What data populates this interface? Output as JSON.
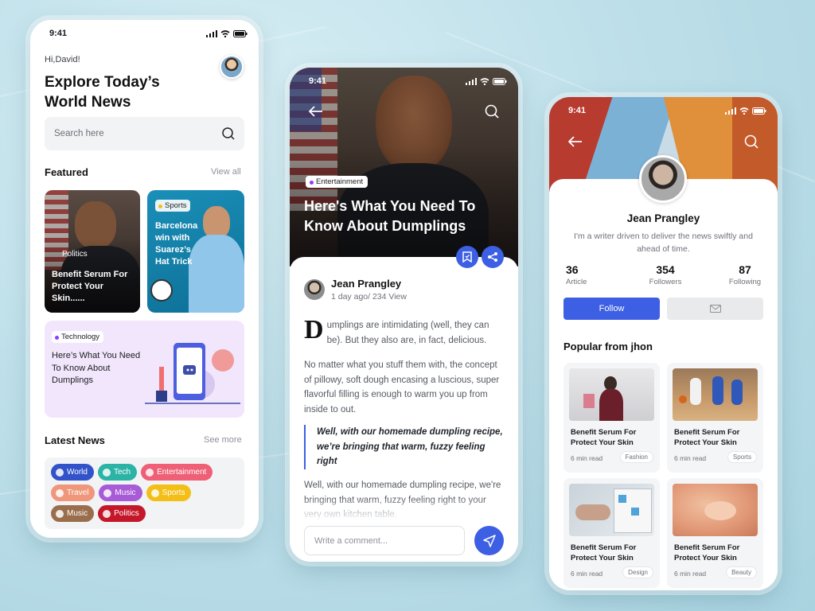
{
  "colors": {
    "accent": "#3d5fe3",
    "background": "#bfe0ea"
  },
  "home": {
    "time": "9:41",
    "greeting": "Hi,David!",
    "headline": "Explore Today’s World News",
    "search_placeholder": "Search here",
    "featured_title": "Featured",
    "featured_link": "View all",
    "featured": [
      {
        "tag": "Politics",
        "title": "Benefit Serum For Protect Your Skin......"
      },
      {
        "tag": "Sports",
        "title": "Barcelona win with Suarez’s Hat Trick"
      },
      {
        "tag": "Technology",
        "title": "Here’s What You Need To Know About Dumplings"
      }
    ],
    "latest_title": "Latest News",
    "latest_link": "See more",
    "categories": [
      {
        "label": "World",
        "color": "#3152c9",
        "icon": "globe-icon"
      },
      {
        "label": "Tech",
        "color": "#2bb3a6",
        "icon": "snowflake-icon"
      },
      {
        "label": "Entertainment",
        "color": "#ef5f76",
        "icon": "flower-icon"
      },
      {
        "label": "Travel",
        "color": "#f0967a",
        "icon": "globe-icon"
      },
      {
        "label": "Music",
        "color": "#a75bd6",
        "icon": "music-icon"
      },
      {
        "label": "Sports",
        "color": "#f3bf17",
        "icon": "sun-icon"
      },
      {
        "label": "Music",
        "color": "#9a6e4c",
        "icon": "music-icon"
      },
      {
        "label": "Politics",
        "color": "#c4172a",
        "icon": "flame-icon"
      }
    ]
  },
  "article": {
    "time": "9:41",
    "tag": "Entertainment",
    "title": "Here's What You Need To Know About Dumplings",
    "author": "Jean Prangley",
    "meta": "1 day ago/ 234 View",
    "dropcap": "D",
    "p1": "umplings are intimidating (well, they can be). But they also are, in fact, delicious.",
    "p2": "No matter what you stuff them with, the concept of pillowy, soft dough encasing a luscious, super flavorful filling is enough to warm you up from inside to out.",
    "quote": "Well, with our homemade dumpling recipe, we’re bringing that warm, fuzzy feeling right",
    "p3": "Well, with our homemade dumpling recipe, we're bringing that warm, fuzzy feeling right to your very own kitchen table.",
    "comment_placeholder": "Write a comment..."
  },
  "profile": {
    "time": "9:41",
    "name": "Jean Prangley",
    "bio": "I'm a writer driven to deliver the news swiftly and ahead of time.",
    "stats": [
      {
        "value": "36",
        "label": "Article"
      },
      {
        "value": "354",
        "label": "Followers"
      },
      {
        "value": "87",
        "label": "Following"
      }
    ],
    "follow_label": "Follow",
    "popular_title": "Popular from jhon",
    "posts": [
      {
        "title": "Benefit Serum For Protect Your Skin",
        "read": "6 min read",
        "badge": "Fashion"
      },
      {
        "title": "Benefit Serum For Protect Your Skin",
        "read": "6 min read",
        "badge": "Sports"
      },
      {
        "title": "Benefit Serum For Protect Your Skin",
        "read": "6 min read",
        "badge": "Design"
      },
      {
        "title": "Benefit Serum For Protect Your Skin",
        "read": "6 min read",
        "badge": "Beauty"
      }
    ]
  }
}
